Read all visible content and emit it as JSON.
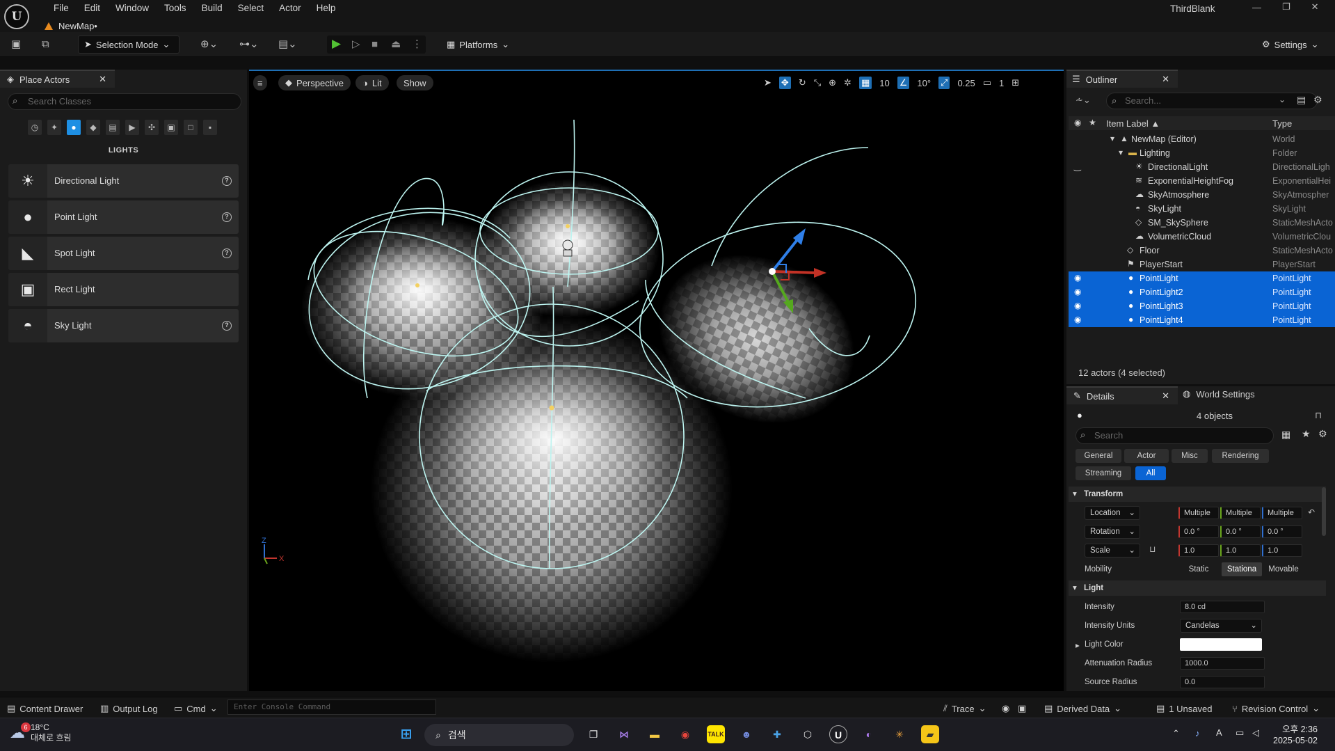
{
  "app": {
    "logo_text": "U",
    "project_name": "ThirdBlank",
    "document_tab": "NewMap•",
    "menu": [
      "File",
      "Edit",
      "Window",
      "Tools",
      "Build",
      "Select",
      "Actor",
      "Help"
    ],
    "window_controls": [
      "—",
      "❐",
      "✕"
    ]
  },
  "toolbar": {
    "selection_mode": "Selection Mode",
    "platforms": "Platforms",
    "settings": "Settings"
  },
  "place_actors": {
    "tab_label": "Place Actors",
    "search_placeholder": "Search Classes",
    "category_heading": "LIGHTS",
    "items": [
      {
        "label": "Directional Light",
        "icon": "directional-light-icon",
        "help": true
      },
      {
        "label": "Point Light",
        "icon": "point-light-icon",
        "help": true
      },
      {
        "label": "Spot Light",
        "icon": "spot-light-icon",
        "help": true
      },
      {
        "label": "Rect Light",
        "icon": "rect-light-icon",
        "help": false
      },
      {
        "label": "Sky Light",
        "icon": "sky-light-icon",
        "help": true
      }
    ]
  },
  "viewport": {
    "menu_icon": "≡",
    "view_mode": "Perspective",
    "lighting_mode": "Lit",
    "show_label": "Show",
    "grid_snap": "10",
    "rotation_snap": "10°",
    "scale_snap": "0.25",
    "camera_speed": "1",
    "axis_labels": {
      "z": "Z",
      "x": "X"
    }
  },
  "outliner": {
    "tab_label": "Outliner",
    "search_placeholder": "Search...",
    "col_label": "Item Label ▲",
    "col_type": "Type",
    "rows": [
      {
        "label": "NewMap (Editor)",
        "type": "World",
        "indent": 0,
        "selected": false
      },
      {
        "label": "Lighting",
        "type": "Folder",
        "indent": 1,
        "selected": false
      },
      {
        "label": "DirectionalLight",
        "type": "DirectionalLigh",
        "indent": 2,
        "selected": false
      },
      {
        "label": "ExponentialHeightFog",
        "type": "ExponentialHei",
        "indent": 2,
        "selected": false
      },
      {
        "label": "SkyAtmosphere",
        "type": "SkyAtmospher",
        "indent": 2,
        "selected": false
      },
      {
        "label": "SkyLight",
        "type": "SkyLight",
        "indent": 2,
        "selected": false
      },
      {
        "label": "SM_SkySphere",
        "type": "StaticMeshActo",
        "indent": 2,
        "selected": false
      },
      {
        "label": "VolumetricCloud",
        "type": "VolumetricClou",
        "indent": 2,
        "selected": false
      },
      {
        "label": "Floor",
        "type": "StaticMeshActo",
        "indent": 1,
        "selected": false
      },
      {
        "label": "PlayerStart",
        "type": "PlayerStart",
        "indent": 1,
        "selected": false
      },
      {
        "label": "PointLight",
        "type": "PointLight",
        "indent": 1,
        "selected": true
      },
      {
        "label": "PointLight2",
        "type": "PointLight",
        "indent": 1,
        "selected": true
      },
      {
        "label": "PointLight3",
        "type": "PointLight",
        "indent": 1,
        "selected": true
      },
      {
        "label": "PointLight4",
        "type": "PointLight",
        "indent": 1,
        "selected": true
      }
    ],
    "actor_count": "12 actors (4 selected)"
  },
  "details": {
    "tab_label": "Details",
    "world_settings_label": "World Settings",
    "object_count": "4 objects",
    "search_placeholder": "Search",
    "filters": [
      "General",
      "Actor",
      "Misc",
      "Rendering",
      "Streaming",
      "All"
    ],
    "active_filter": "All",
    "transform": {
      "heading": "Transform",
      "location_label": "Location",
      "location": [
        "Multiple",
        "Multiple",
        "Multiple"
      ],
      "rotation_label": "Rotation",
      "rotation": [
        "0.0 °",
        "0.0 °",
        "0.0 °"
      ],
      "scale_label": "Scale",
      "scale": [
        "1.0",
        "1.0",
        "1.0"
      ],
      "mobility_label": "Mobility",
      "mobility_options": [
        "Static",
        "Stationa",
        "Movable"
      ],
      "mobility_selected": "Stationa"
    },
    "light": {
      "heading": "Light",
      "intensity_label": "Intensity",
      "intensity": "8.0 cd",
      "units_label": "Intensity Units",
      "units": "Candelas",
      "color_label": "Light Color",
      "color": "#ffffff",
      "attenuation_label": "Attenuation Radius",
      "attenuation": "1000.0",
      "source_radius_label": "Source Radius",
      "source_radius": "0.0"
    }
  },
  "bottom_bar": {
    "content_drawer": "Content Drawer",
    "output_log": "Output Log",
    "cmd": "Cmd",
    "console_placeholder": "Enter Console Command",
    "trace": "Trace",
    "derived_data": "Derived Data",
    "unsaved": "1 Unsaved",
    "revision_control": "Revision Control"
  },
  "taskbar": {
    "weather_badge": "6",
    "temperature": "18°C",
    "weather_desc": "대체로 흐림",
    "search_text": "검색",
    "time": "오후 2:36",
    "date": "2025-05-02"
  },
  "colors": {
    "accent": "#0a64d4",
    "selection_ring": "#bdf4f0",
    "play_green": "#52c234"
  }
}
